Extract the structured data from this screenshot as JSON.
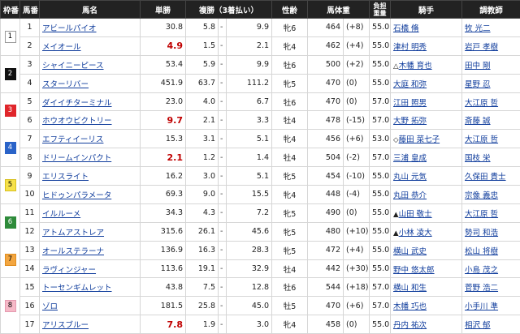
{
  "header": {
    "waku": "枠番",
    "umaban": "馬番",
    "name": "馬名",
    "win": "単勝",
    "place": "複勝（3着払い）",
    "sexage": "性齢",
    "weight": "馬体重",
    "burden": "負担重量",
    "jockey": "騎手",
    "trainer": "調教師"
  },
  "waku_colors": {
    "1": {
      "bg": "#ffffff",
      "fg": "#000000",
      "border": "#999999"
    },
    "2": {
      "bg": "#111111",
      "fg": "#ffffff",
      "border": "#111111"
    },
    "3": {
      "bg": "#e0262b",
      "fg": "#ffffff",
      "border": "#e0262b"
    },
    "4": {
      "bg": "#2a63c8",
      "fg": "#ffffff",
      "border": "#2a63c8"
    },
    "5": {
      "bg": "#f6e14a",
      "fg": "#000000",
      "border": "#d8c020"
    },
    "6": {
      "bg": "#2e8b3a",
      "fg": "#ffffff",
      "border": "#2e8b3a"
    },
    "7": {
      "bg": "#f3a640",
      "fg": "#000000",
      "border": "#e08e20"
    },
    "8": {
      "bg": "#f6b9c7",
      "fg": "#000000",
      "border": "#e59ab0"
    }
  },
  "rows": [
    {
      "waku": "1",
      "umaban": "1",
      "name": "アビールパイオ",
      "win": "30.8",
      "place_low": "5.8",
      "place_sep": "-",
      "place_high": "9.9",
      "sexage": "牝6",
      "weight": "464",
      "diff": "(+8)",
      "burden": "55.0",
      "jockey_mark": "",
      "jockey": "石橋 脩",
      "trainer_mark": "",
      "trainer": "牧 光二"
    },
    {
      "waku": "",
      "umaban": "2",
      "name": "メイオール",
      "win": "4.9",
      "place_low": "1.5",
      "place_sep": "-",
      "place_high": "2.1",
      "sexage": "牝4",
      "weight": "462",
      "diff": "(+4)",
      "burden": "55.0",
      "jockey_mark": "",
      "jockey": "津村 明秀",
      "trainer_mark": "",
      "trainer": "岩戸 孝樹"
    },
    {
      "waku": "2",
      "umaban": "3",
      "name": "シャイニーピース",
      "win": "53.4",
      "place_low": "5.9",
      "place_sep": "-",
      "place_high": "9.9",
      "sexage": "牡6",
      "weight": "500",
      "diff": "(+2)",
      "burden": "55.0",
      "jockey_mark": "△",
      "jockey": "木幡 育也",
      "trainer_mark": "",
      "trainer": "田中 剛"
    },
    {
      "waku": "",
      "umaban": "4",
      "name": "スターリバー",
      "win": "451.9",
      "place_low": "63.7",
      "place_sep": "-",
      "place_high": "111.2",
      "sexage": "牝5",
      "weight": "470",
      "diff": "(0)",
      "burden": "55.0",
      "jockey_mark": "",
      "jockey": "大庭 和弥",
      "trainer_mark": "",
      "trainer": "星野 忍"
    },
    {
      "waku": "3",
      "umaban": "5",
      "name": "ダイイチターミナル",
      "win": "23.0",
      "place_low": "4.0",
      "place_sep": "-",
      "place_high": "6.7",
      "sexage": "牡6",
      "weight": "470",
      "diff": "(0)",
      "burden": "57.0",
      "jockey_mark": "",
      "jockey": "江田 照男",
      "trainer_mark": "",
      "trainer": "大江原 哲"
    },
    {
      "waku": "",
      "umaban": "6",
      "name": "ホウオウビクトリー",
      "win": "9.7",
      "place_low": "2.1",
      "place_sep": "-",
      "place_high": "3.3",
      "sexage": "牡4",
      "weight": "478",
      "diff": "(-15)",
      "burden": "57.0",
      "jockey_mark": "",
      "jockey": "大野 拓弥",
      "trainer_mark": "",
      "trainer": "斎藤 誠"
    },
    {
      "waku": "4",
      "umaban": "7",
      "name": "エフティイーリス",
      "win": "15.3",
      "place_low": "3.1",
      "place_sep": "-",
      "place_high": "5.1",
      "sexage": "牝4",
      "weight": "456",
      "diff": "(+6)",
      "burden": "53.0",
      "jockey_mark": "◇",
      "jockey": "藤田 菜七子",
      "trainer_mark": "",
      "trainer": "大江原 哲"
    },
    {
      "waku": "",
      "umaban": "8",
      "name": "ドリームインパクト",
      "win": "2.1",
      "place_low": "1.2",
      "place_sep": "-",
      "place_high": "1.4",
      "sexage": "牡4",
      "weight": "504",
      "diff": "(-2)",
      "burden": "57.0",
      "jockey_mark": "",
      "jockey": "三浦 皇成",
      "trainer_mark": "",
      "trainer": "国枝 栄"
    },
    {
      "waku": "5",
      "umaban": "9",
      "name": "エリスライト",
      "win": "16.2",
      "place_low": "3.0",
      "place_sep": "-",
      "place_high": "5.1",
      "sexage": "牝5",
      "weight": "454",
      "diff": "(-10)",
      "burden": "55.0",
      "jockey_mark": "",
      "jockey": "丸山 元気",
      "trainer_mark": "",
      "trainer": "久保田 貴士"
    },
    {
      "waku": "",
      "umaban": "10",
      "name": "ヒドゥンパラメータ",
      "win": "69.3",
      "place_low": "9.0",
      "place_sep": "-",
      "place_high": "15.5",
      "sexage": "牝4",
      "weight": "448",
      "diff": "(-4)",
      "burden": "55.0",
      "jockey_mark": "",
      "jockey": "丸田 恭介",
      "trainer_mark": "",
      "trainer": "宗像 義忠"
    },
    {
      "waku": "6",
      "umaban": "11",
      "name": "イルルーメ",
      "win": "34.3",
      "place_low": "4.3",
      "place_sep": "-",
      "place_high": "7.2",
      "sexage": "牝5",
      "weight": "490",
      "diff": "(0)",
      "burden": "55.0",
      "jockey_mark": "▲",
      "jockey": "山田 敬士",
      "trainer_mark": "",
      "trainer": "大江原 哲"
    },
    {
      "waku": "",
      "umaban": "12",
      "name": "アトムアストレア",
      "win": "315.6",
      "place_low": "26.1",
      "place_sep": "-",
      "place_high": "45.6",
      "sexage": "牝5",
      "weight": "480",
      "diff": "(+10)",
      "burden": "55.0",
      "jockey_mark": "▲",
      "jockey": "小林 凌大",
      "trainer_mark": "",
      "trainer": "勢司 和浩"
    },
    {
      "waku": "7",
      "umaban": "13",
      "name": "オールステラーナ",
      "win": "136.9",
      "place_low": "16.3",
      "place_sep": "-",
      "place_high": "28.3",
      "sexage": "牝5",
      "weight": "472",
      "diff": "(+4)",
      "burden": "55.0",
      "jockey_mark": "",
      "jockey": "横山 武史",
      "trainer_mark": "",
      "trainer": "松山 将樹"
    },
    {
      "waku": "",
      "umaban": "14",
      "name": "ラヴィンジャー",
      "win": "113.6",
      "place_low": "19.1",
      "place_sep": "-",
      "place_high": "32.9",
      "sexage": "牡4",
      "weight": "442",
      "diff": "(+30)",
      "burden": "55.0",
      "jockey_mark": "",
      "jockey": "野中 悠太郎",
      "trainer_mark": "",
      "trainer": "小島 茂之"
    },
    {
      "waku": "8",
      "umaban": "15",
      "name": "トーセンギムレット",
      "win": "43.8",
      "place_low": "7.5",
      "place_sep": "-",
      "place_high": "12.8",
      "sexage": "牡6",
      "weight": "544",
      "diff": "(+18)",
      "burden": "57.0",
      "jockey_mark": "",
      "jockey": "横山 和生",
      "trainer_mark": "",
      "trainer": "菅野 浩二"
    },
    {
      "waku": "",
      "umaban": "16",
      "name": "ゾロ",
      "win": "181.5",
      "place_low": "25.8",
      "place_sep": "-",
      "place_high": "45.0",
      "sexage": "牡5",
      "weight": "470",
      "diff": "(+6)",
      "burden": "57.0",
      "jockey_mark": "",
      "jockey": "木幡 巧也",
      "trainer_mark": "",
      "trainer": "小手川 準"
    },
    {
      "waku": "",
      "umaban": "17",
      "name": "アリスブルー",
      "win": "7.8",
      "place_low": "1.9",
      "place_sep": "-",
      "place_high": "3.0",
      "sexage": "牝4",
      "weight": "458",
      "diff": "(0)",
      "burden": "55.0",
      "jockey_mark": "",
      "jockey": "丹内 祐次",
      "trainer_mark": "",
      "trainer": "相沢 郁"
    }
  ]
}
